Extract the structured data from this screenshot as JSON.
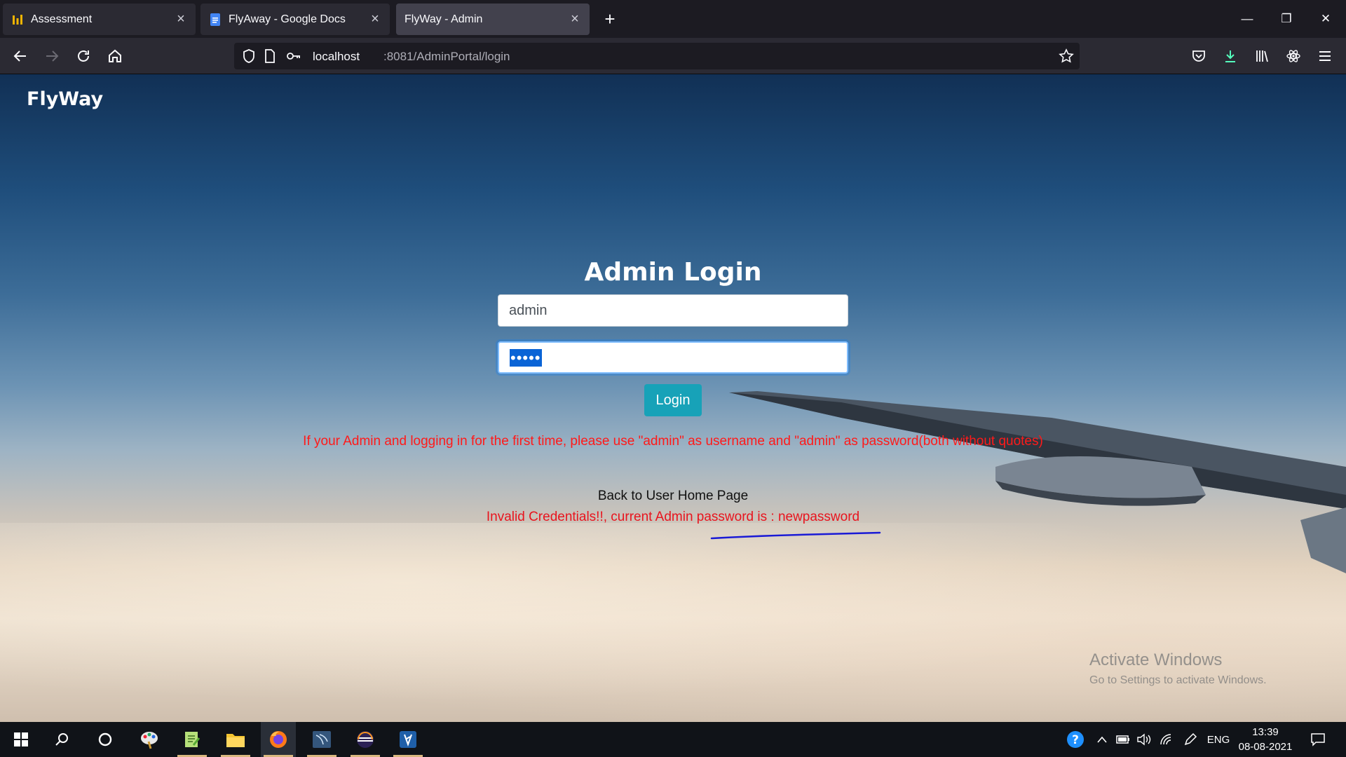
{
  "browser": {
    "tabs": [
      {
        "label": "Assessment",
        "icon": "assessment-icon",
        "active": false
      },
      {
        "label": "FlyAway - Google Docs",
        "icon": "google-docs-icon",
        "active": false
      },
      {
        "label": "FlyWay - Admin",
        "icon": "",
        "active": true
      }
    ],
    "url_host": "localhost",
    "url_rest": ":8081/AdminPortal/login"
  },
  "page": {
    "brand": "FlyWay",
    "login_title": "Admin Login",
    "username_value": "admin",
    "password_mask": "•••••",
    "login_label": "Login",
    "first_time_note": "If your Admin and logging in for the first time, please use \"admin\" as username and \"admin\" as password(both without quotes)",
    "back_link": "Back to User Home Page",
    "error_message": "Invalid Credentials!!, current Admin password is : newpassword",
    "annotation_color": "#1a1ad6"
  },
  "watermark": {
    "title": "Activate Windows",
    "subtitle": "Go to Settings to activate Windows."
  },
  "taskbar": {
    "language": "ENG",
    "time": "13:39",
    "date": "08-08-2021"
  },
  "colors": {
    "login_button": "#17a2b8",
    "error_text": "#e8141e"
  }
}
